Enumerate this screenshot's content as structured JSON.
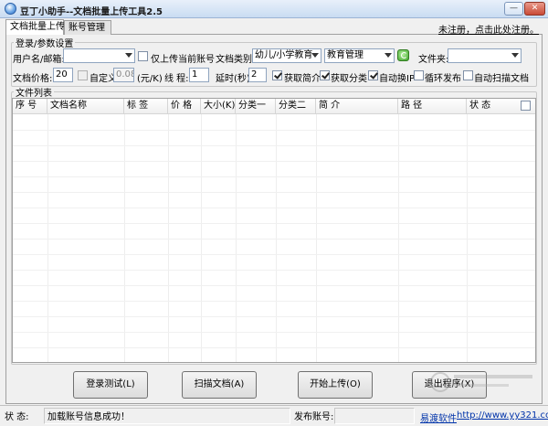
{
  "window": {
    "title": "豆丁小助手--文档批量上传工具2.5",
    "minimize_glyph": "—",
    "close_glyph": "✕"
  },
  "tabs": [
    {
      "label": "文档批量上传",
      "active": true
    },
    {
      "label": "账号管理",
      "active": false
    }
  ],
  "register_link": "未注册，点击此处注册。",
  "login_group": {
    "legend": "登录/参数设置",
    "username_label": "用户名/邮箱:",
    "username_value": "",
    "only_current_label": "仅上传当前账号",
    "only_current_checked": false,
    "doc_category_label": "文档类别:",
    "doc_category_value": "幼儿/小学教育",
    "doc_subcategory_value": "教育管理",
    "folder_label": "文件夹:",
    "folder_value": "",
    "price_label": "文档价格:",
    "price_value": "20",
    "custom_label": "自定义",
    "custom_checked": false,
    "custom_value": "0.08",
    "unit_label": "(元/K)",
    "threads_label": "线  程:",
    "threads_value": "1",
    "delay_label": "延时(秒):",
    "delay_value": "2",
    "options": [
      {
        "label": "获取简介",
        "checked": true
      },
      {
        "label": "获取分类",
        "checked": true
      },
      {
        "label": "自动换IP",
        "checked": true
      },
      {
        "label": "循环发布",
        "checked": false
      },
      {
        "label": "自动扫描文档",
        "checked": false
      }
    ]
  },
  "file_list": {
    "legend": "文件列表",
    "columns": [
      "序  号",
      "文档名称",
      "标  签",
      "价  格",
      "大小(K)",
      "分类一",
      "分类二",
      "简  介",
      "路  径",
      "状  态"
    ],
    "rows": []
  },
  "buttons": {
    "login_test": "登录测试(L)",
    "scan_docs": "扫描文档(A)",
    "start_upload": "开始上传(O)",
    "exit": "退出程序(X)"
  },
  "statusbar": {
    "status_label": "状  态:",
    "status_text": "加载账号信息成功！",
    "publish_account_label": "发布账号:",
    "publish_account_value": "",
    "vendor": "易渡软件",
    "url": "http://www.yy321.com"
  }
}
